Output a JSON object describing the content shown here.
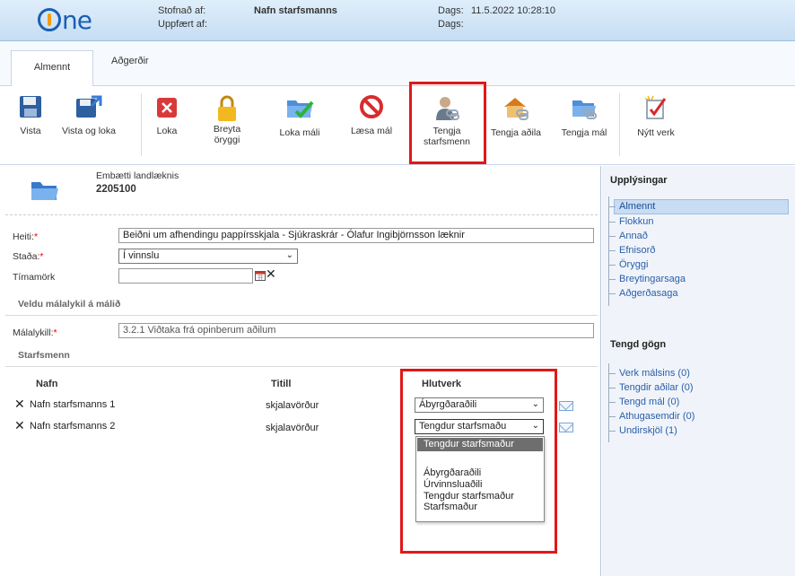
{
  "header": {
    "logo": "One",
    "created_by_label": "Stofnað af:",
    "created_by_value": "Nafn starfsmanns",
    "updated_by_label": "Uppfært af:",
    "date_label_1": "Dags:",
    "date_value_1": "11.5.2022 10:28:10",
    "date_label_2": "Dags:"
  },
  "tabs": [
    {
      "label": "Almennt",
      "active": true
    },
    {
      "label": "Aðgerðir",
      "active": false
    }
  ],
  "toolbar": {
    "save": "Vista",
    "save_close": "Vista og loka",
    "close": "Loka",
    "change_security_1": "Breyta",
    "change_security_2": "öryggi",
    "close_case": "Loka máli",
    "lock_case": "Læsa mál",
    "link_staff_1": "Tengja",
    "link_staff_2": "starfsmenn",
    "link_party": "Tengja aðila",
    "link_case": "Tengja mál",
    "new_task": "Nýtt verk"
  },
  "case": {
    "org": "Embætti landlæknis",
    "number": "2205100"
  },
  "form": {
    "title_label": "Heiti:",
    "title_value": "Beiðni um afhendingu pappírsskjala - Sjúkraskrár - Ólafur Ingibjörnsson læknir",
    "status_label": "Staða:",
    "status_value": "Í vinnslu",
    "deadline_label": "Tímamörk",
    "keyword_section": "Veldu málalykil á málið",
    "keyword_label": "Málalykill:",
    "keyword_value": "3.2.1 Viðtaka frá opinberum aðilum",
    "staff_section": "Starfsmenn"
  },
  "staff_table": {
    "col_name": "Nafn",
    "col_title": "Titill",
    "col_role": "Hlutverk",
    "rows": [
      {
        "name": "Nafn starfsmanns 1",
        "title": "skjalavörður",
        "role": "Ábyrgðaraðili"
      },
      {
        "name": "Nafn starfsmanns 2",
        "title": "skjalavörður",
        "role": "Tengdur starfsmaðu"
      }
    ]
  },
  "role_dropdown": {
    "selected": "Tengdur starfsmaður",
    "options": [
      "Ábyrgðaraðili",
      "Úrvinnsluaðili",
      "Tengdur starfsmaður",
      "Starfsmaður"
    ]
  },
  "right_panel": {
    "info_title": "Upplýsingar",
    "info_items": [
      "Almennt",
      "Flokkun",
      "Annað",
      "Efnisorð",
      "Öryggi",
      "Breytingarsaga",
      "Aðgerðasaga"
    ],
    "docs_title": "Tengd gögn",
    "doc_items": [
      "Verk málsins (0)",
      "Tengdir aðilar (0)",
      "Tengd mál (0)",
      "Athugasemdir (0)",
      "Undirskjöl (1)"
    ]
  }
}
